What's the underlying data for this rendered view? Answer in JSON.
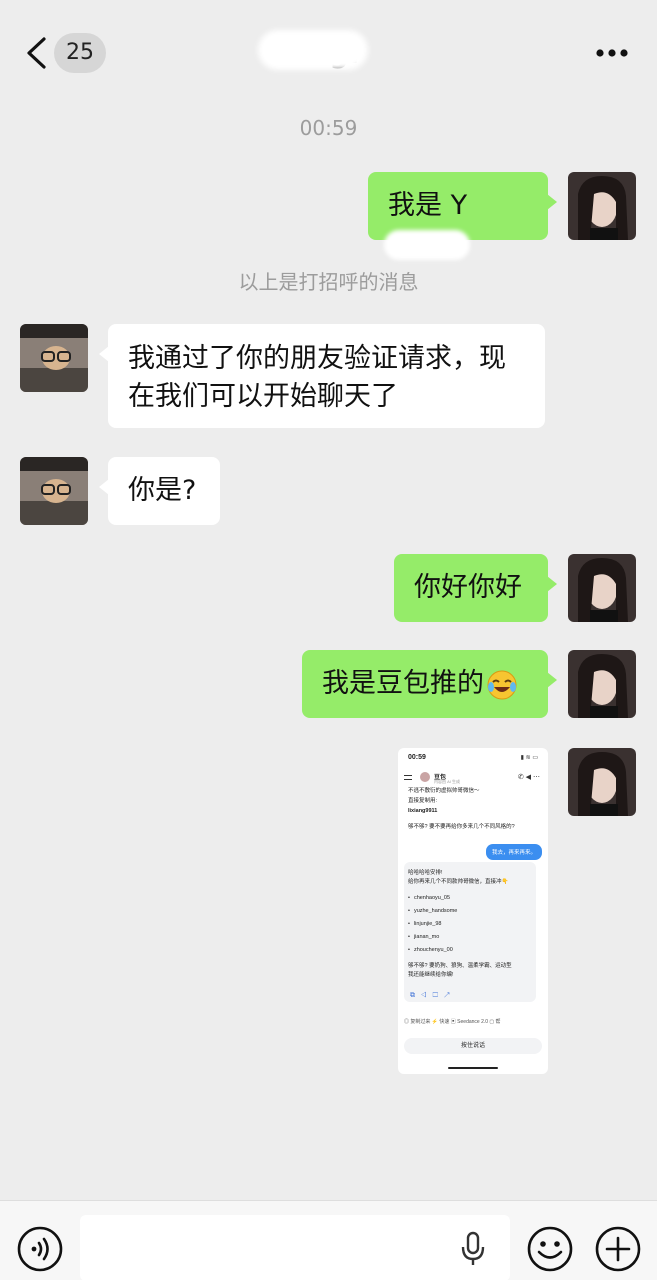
{
  "header": {
    "unread_count": "25",
    "title": "N        g.",
    "back_icon": "chevron-left-icon",
    "more_icon": "ellipsis-icon"
  },
  "timestamp": "00:59",
  "system_note": "以上是打招呼的消息",
  "messages": [
    {
      "side": "me",
      "text": "我是 Y"
    },
    {
      "side": "other",
      "text_line1": "我通过了你的朋友验证请求，现",
      "text_line2": "在我们可以开始聊天了"
    },
    {
      "side": "other",
      "text": "你是?"
    },
    {
      "side": "me",
      "text": "你好你好"
    },
    {
      "side": "me",
      "text": "我是豆包推的",
      "emoji": "laughing-crying-emoji"
    }
  ],
  "embedded_screenshot": {
    "status_time": "00:59",
    "bot_name": "豆包",
    "bot_sub": "内容由 AI 生成",
    "line1": "不逃不敷衍的虚拟帅哥微信～",
    "line2": "直接复制用:",
    "wechat_id": "lixiang9911",
    "question": "够不够? 要不要再给你多来几个不同风格的?",
    "user_reply": "我去，再来再来。",
    "reply_line1": "哈哈哈哈安排!",
    "reply_line2": "给你再来几个不同款帅哥微信，直接冲👇",
    "ids": [
      "chenhaoyu_05",
      "yuzhe_handsome",
      "linjunjie_98",
      "jianan_mo",
      "zhouchenyu_00"
    ],
    "tail_line1": "够不够? 要奶狗、狼狗、温柔学霸、运动型",
    "tail_line2": "我还能继续给你编!",
    "bottom_tools": "◎ 复制过来    ⚡ 快速    ▣ Seedance 2.0    ▢ 帮",
    "input_placeholder": "按住说话"
  },
  "footer": {
    "input_value": "",
    "voice_icon": "voice-icon",
    "mic_icon": "microphone-icon",
    "emoji_icon": "smiley-icon",
    "plus_icon": "plus-icon"
  },
  "colors": {
    "background": "#ededed",
    "my_bubble": "#95ec69",
    "their_bubble": "#ffffff",
    "timestamp_text": "#9c9c9c"
  }
}
